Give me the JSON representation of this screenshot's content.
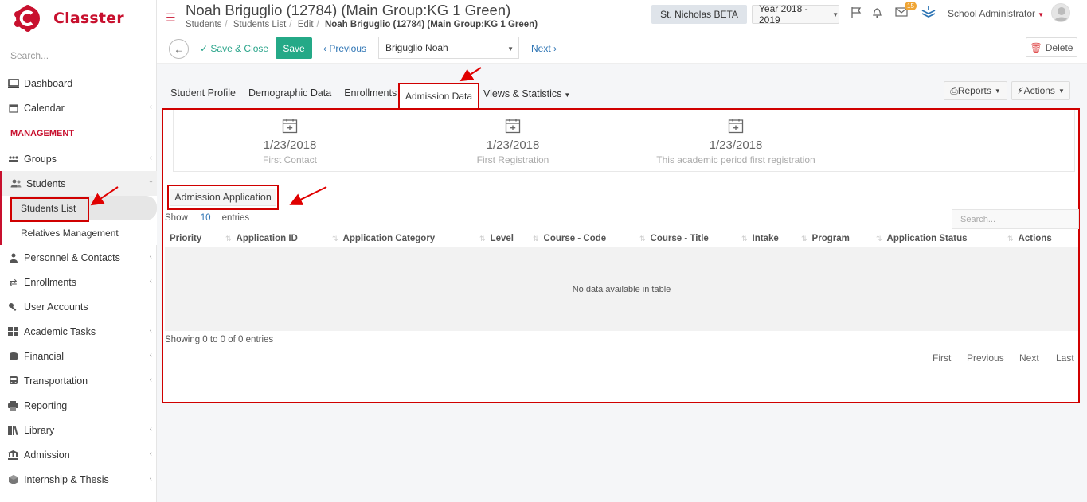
{
  "brand": {
    "name": "Classter"
  },
  "sidebar": {
    "search_placeholder": "Search...",
    "items": [
      {
        "label": "Dashboard"
      },
      {
        "label": "Calendar"
      }
    ],
    "section": "MANAGEMENT",
    "mgmt": [
      {
        "label": "Groups"
      },
      {
        "label": "Students"
      },
      {
        "label": "Students List"
      },
      {
        "label": "Relatives Management"
      },
      {
        "label": "Personnel & Contacts"
      },
      {
        "label": "Enrollments"
      },
      {
        "label": "User Accounts"
      },
      {
        "label": "Academic Tasks"
      },
      {
        "label": "Financial"
      },
      {
        "label": "Transportation"
      },
      {
        "label": "Reporting"
      },
      {
        "label": "Library"
      },
      {
        "label": "Admission"
      },
      {
        "label": "Internship & Thesis"
      }
    ]
  },
  "header": {
    "title": "Noah Briguglio (12784) (Main Group:KG 1 Green)",
    "breadcrumb": [
      "Students",
      "Students List",
      "Edit",
      "Noah Briguglio (12784) (Main Group:KG 1 Green)"
    ],
    "school": "St. Nicholas BETA",
    "year": "Year 2018 - 2019",
    "mail_count": "15",
    "user": "School Administrator"
  },
  "toolbar": {
    "save_close": "Save & Close",
    "save": "Save",
    "previous": "Previous",
    "student_select": "Briguglio Noah",
    "next": "Next",
    "delete": "Delete"
  },
  "tabs": {
    "items": [
      "Student Profile",
      "Demographic Data",
      "Enrollments"
    ],
    "active": "Admission Data",
    "views": "Views & Statistics",
    "reports": "Reports",
    "actions": "Actions"
  },
  "dates": [
    {
      "value": "1/23/2018",
      "label": "First Contact"
    },
    {
      "value": "1/23/2018",
      "label": "First Registration"
    },
    {
      "value": "1/23/2018",
      "label": "This academic period first registration"
    }
  ],
  "table": {
    "subtab": "Admission Application",
    "show": "Show",
    "length": "10",
    "entries": "entries",
    "search_placeholder": "Search...",
    "columns": [
      "Priority",
      "Application ID",
      "Application Category",
      "Level",
      "Course - Code",
      "Course - Title",
      "Intake",
      "Program",
      "Application Status",
      "Actions"
    ],
    "empty": "No data available in table",
    "info": "Showing 0 to 0 of 0 entries",
    "pager": [
      "First",
      "Previous",
      "Next",
      "Last"
    ]
  },
  "colors": {
    "brand": "#c8102e",
    "accent_green": "#24a987",
    "link": "#2d74b4",
    "highlight": "#d00000"
  }
}
